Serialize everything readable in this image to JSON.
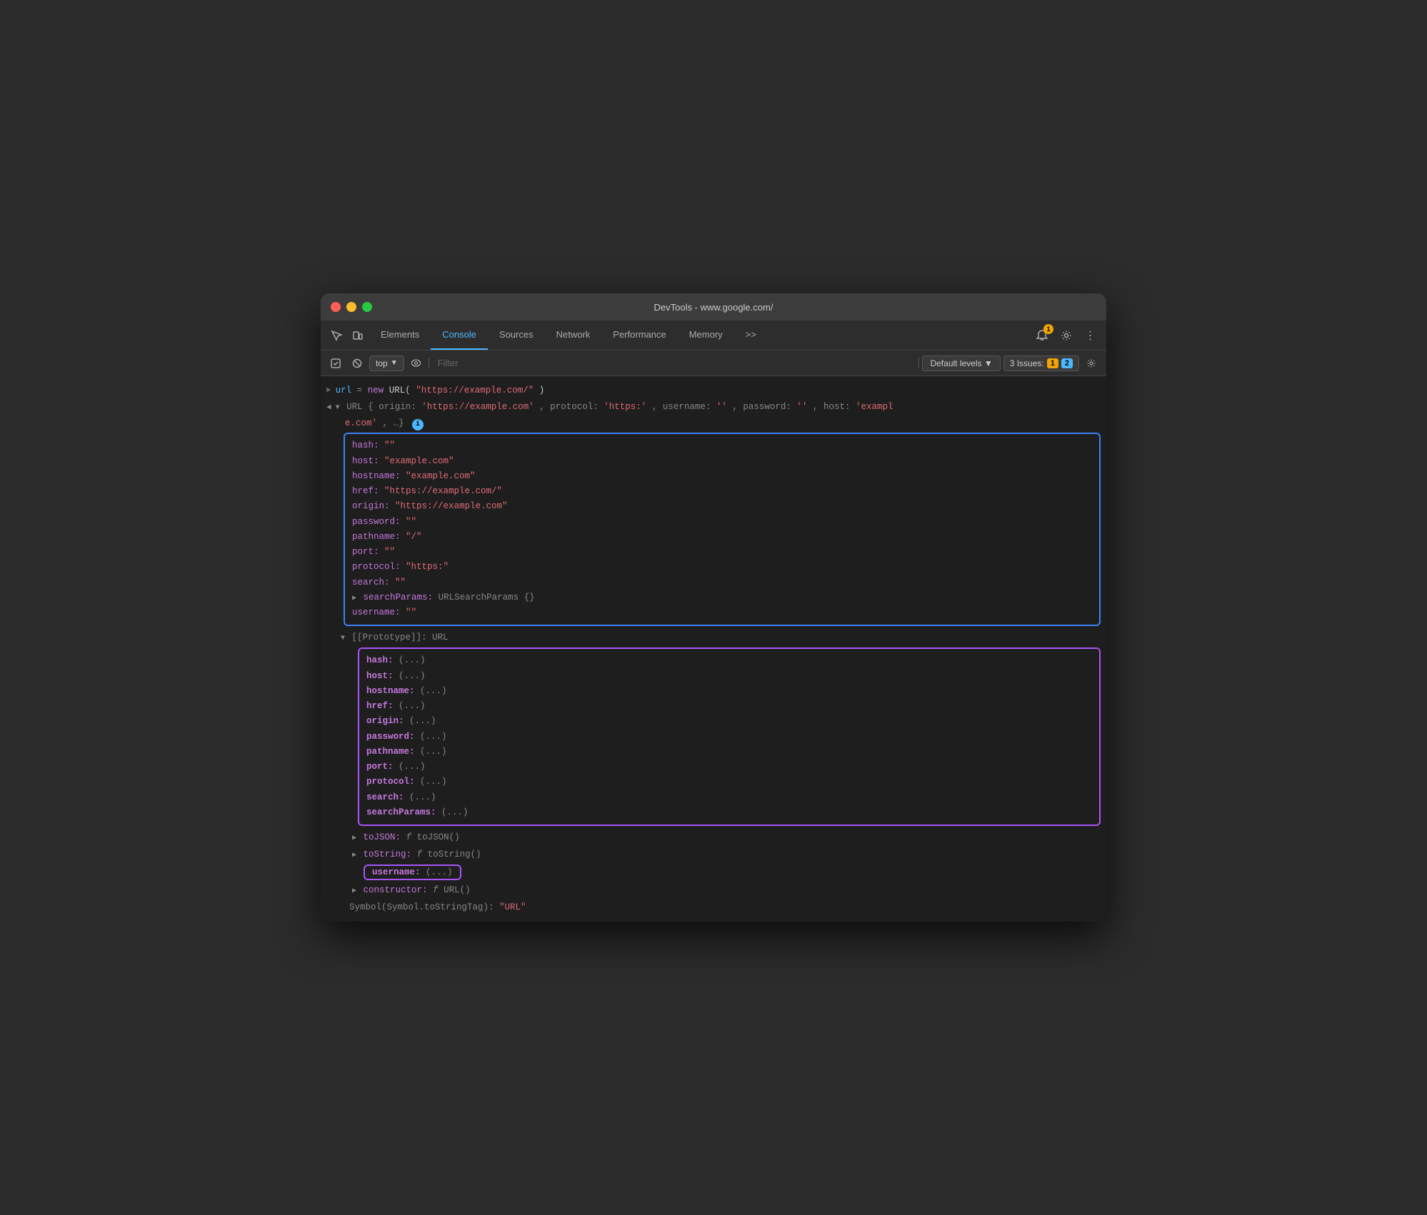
{
  "window": {
    "title": "DevTools - www.google.com/"
  },
  "tabs": {
    "items": [
      {
        "label": "Elements",
        "active": false
      },
      {
        "label": "Console",
        "active": true
      },
      {
        "label": "Sources",
        "active": false
      },
      {
        "label": "Network",
        "active": false
      },
      {
        "label": "Performance",
        "active": false
      },
      {
        "label": "Memory",
        "active": false
      }
    ],
    "more_label": ">>"
  },
  "toolbar": {
    "filter_placeholder": "Filter",
    "top_label": "top",
    "levels_label": "Default levels ▼",
    "issues_label": "3 Issues:",
    "warn_count": "1",
    "info_count": "2"
  },
  "console": {
    "line1": "url = new URL(\"https://example.com/\")",
    "url_obj_header": "▼ URL {origin: 'https://example.com', protocol: 'https:', username: '', password: '', host: 'example.com', …}",
    "url_obj_header_short": "URL {origin: ",
    "url_prototype_label": "▼ [[Prototype]]: URL",
    "blue_box_items": [
      "hash: \"\"",
      "host: \"example.com\"",
      "hostname: \"example.com\"",
      "href: \"https://example.com/\"",
      "origin: \"https://example.com\"",
      "password: \"\"",
      "pathname: \"/\"",
      "port: \"\"",
      "protocol: \"https:\"",
      "search: \"\"",
      "▶ searchParams: URLSearchParams {}",
      "username: \"\""
    ],
    "purple_box_items": [
      "hash: (...)",
      "host: (...)",
      "hostname: (...)",
      "href: (...)",
      "origin: (...)",
      "password: (...)",
      "pathname: (...)",
      "port: (...)",
      "protocol: (...)",
      "search: (...)",
      "searchParams: (...)"
    ],
    "tojson_line": "▶ toJSON: f toJSON()",
    "tostring_line": "▶ toString: f toString()",
    "username_purple": "username: (...)",
    "constructor_line": "▶ constructor: f URL()",
    "symbol_line": "Symbol(Symbol.toStringTag): \"URL\""
  }
}
